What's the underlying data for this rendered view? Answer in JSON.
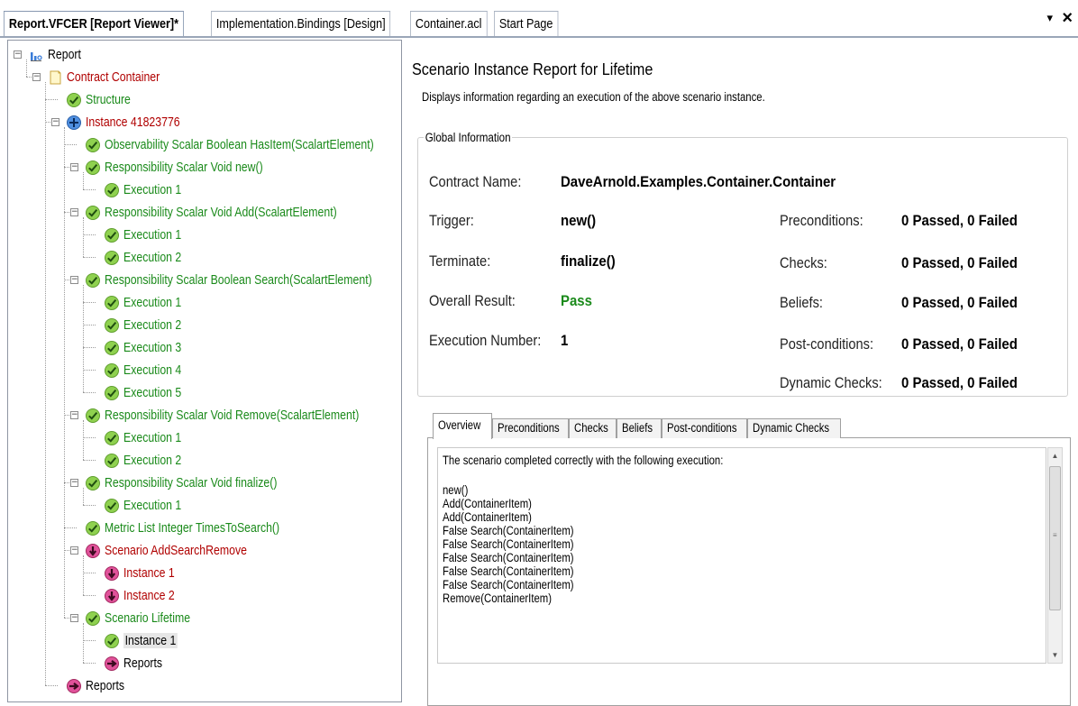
{
  "tabs": [
    {
      "label": "Report.VFCER [Report Viewer]*",
      "active": true
    },
    {
      "label": "Implementation.Bindings [Design]",
      "active": false
    },
    {
      "label": "Container.acl",
      "active": false
    },
    {
      "label": "Start Page",
      "active": false
    }
  ],
  "tab_controls": {
    "dropdown": "▾",
    "close": "×"
  },
  "tree": [
    {
      "label": "Report",
      "color": "black",
      "icon": "report-icon"
    },
    {
      "label": "Contract Container",
      "color": "red",
      "icon": "contract-icon"
    },
    {
      "label": "Structure",
      "color": "green",
      "icon": "check-icon"
    },
    {
      "label": "Instance 41823776",
      "color": "red",
      "icon": "plus-circle-icon"
    },
    {
      "label": "Observability Scalar Boolean HasItem(ScalartElement)",
      "color": "green",
      "icon": "check-icon"
    },
    {
      "label": "Responsibility Scalar Void new()",
      "color": "green",
      "icon": "check-icon"
    },
    {
      "label": "Execution 1",
      "color": "green",
      "icon": "check-icon"
    },
    {
      "label": "Responsibility Scalar Void Add(ScalartElement)",
      "color": "green",
      "icon": "check-icon"
    },
    {
      "label": "Execution 1",
      "color": "green",
      "icon": "check-icon"
    },
    {
      "label": "Execution 2",
      "color": "green",
      "icon": "check-icon"
    },
    {
      "label": "Responsibility Scalar Boolean Search(ScalartElement)",
      "color": "green",
      "icon": "check-icon"
    },
    {
      "label": "Execution 1",
      "color": "green",
      "icon": "check-icon"
    },
    {
      "label": "Execution 2",
      "color": "green",
      "icon": "check-icon"
    },
    {
      "label": "Execution 3",
      "color": "green",
      "icon": "check-icon"
    },
    {
      "label": "Execution 4",
      "color": "green",
      "icon": "check-icon"
    },
    {
      "label": "Execution 5",
      "color": "green",
      "icon": "check-icon"
    },
    {
      "label": "Responsibility Scalar Void Remove(ScalartElement)",
      "color": "green",
      "icon": "check-icon"
    },
    {
      "label": "Execution 1",
      "color": "green",
      "icon": "check-icon"
    },
    {
      "label": "Execution 2",
      "color": "green",
      "icon": "check-icon"
    },
    {
      "label": "Responsibility Scalar Void finalize()",
      "color": "green",
      "icon": "check-icon"
    },
    {
      "label": "Execution 1",
      "color": "green",
      "icon": "check-icon"
    },
    {
      "label": "Metric List Integer TimesToSearch()",
      "color": "green",
      "icon": "check-icon"
    },
    {
      "label": "Scenario AddSearchRemove",
      "color": "red",
      "icon": "down-arrow-icon"
    },
    {
      "label": "Instance 1",
      "color": "red",
      "icon": "down-arrow-icon"
    },
    {
      "label": "Instance 2",
      "color": "red",
      "icon": "down-arrow-icon"
    },
    {
      "label": "Scenario Lifetime",
      "color": "green",
      "icon": "check-icon"
    },
    {
      "label": "Instance 1",
      "color": "black",
      "icon": "check-icon",
      "selected": true
    },
    {
      "label": "Reports",
      "color": "black",
      "icon": "right-arrow-icon"
    },
    {
      "label": "Reports",
      "color": "black",
      "icon": "right-arrow-icon"
    }
  ],
  "report": {
    "title": "Scenario Instance Report for Lifetime",
    "description": "Displays information regarding an execution of the above scenario instance.",
    "group_title": "Global Information",
    "contract_name_label": "Contract Name:",
    "contract_name": "DaveArnold.Examples.Container.Container",
    "trigger_label": "Trigger:",
    "trigger": "new()",
    "terminate_label": "Terminate:",
    "terminate": "finalize()",
    "overall_result_label": "Overall Result:",
    "overall_result": "Pass",
    "execution_number_label": "Execution Number:",
    "execution_number": "1",
    "preconditions_label": "Preconditions:",
    "preconditions": "0 Passed, 0 Failed",
    "checks_label": "Checks:",
    "checks": "0 Passed, 0 Failed",
    "beliefs_label": "Beliefs:",
    "beliefs": "0 Passed, 0 Failed",
    "postconditions_label": "Post-conditions:",
    "postconditions": "0 Passed, 0 Failed",
    "dynamic_checks_label": "Dynamic Checks:",
    "dynamic_checks": "0 Passed, 0 Failed"
  },
  "inner_tabs": [
    "Overview",
    "Preconditions",
    "Checks",
    "Beliefs",
    "Post-conditions",
    "Dynamic Checks"
  ],
  "overview_lines": [
    "The scenario completed correctly with the following execution:",
    "",
    "new()",
    "Add(ContainerItem)",
    "Add(ContainerItem)",
    "False Search(ContainerItem)",
    "False Search(ContainerItem)",
    "False Search(ContainerItem)",
    "False Search(ContainerItem)",
    "False Search(ContainerItem)",
    "Remove(ContainerItem)"
  ],
  "colors": {
    "green": "#1a8a1a",
    "red": "#b00000",
    "check_fill": "#8fd14f",
    "arrow_fill": "#e0529a"
  }
}
